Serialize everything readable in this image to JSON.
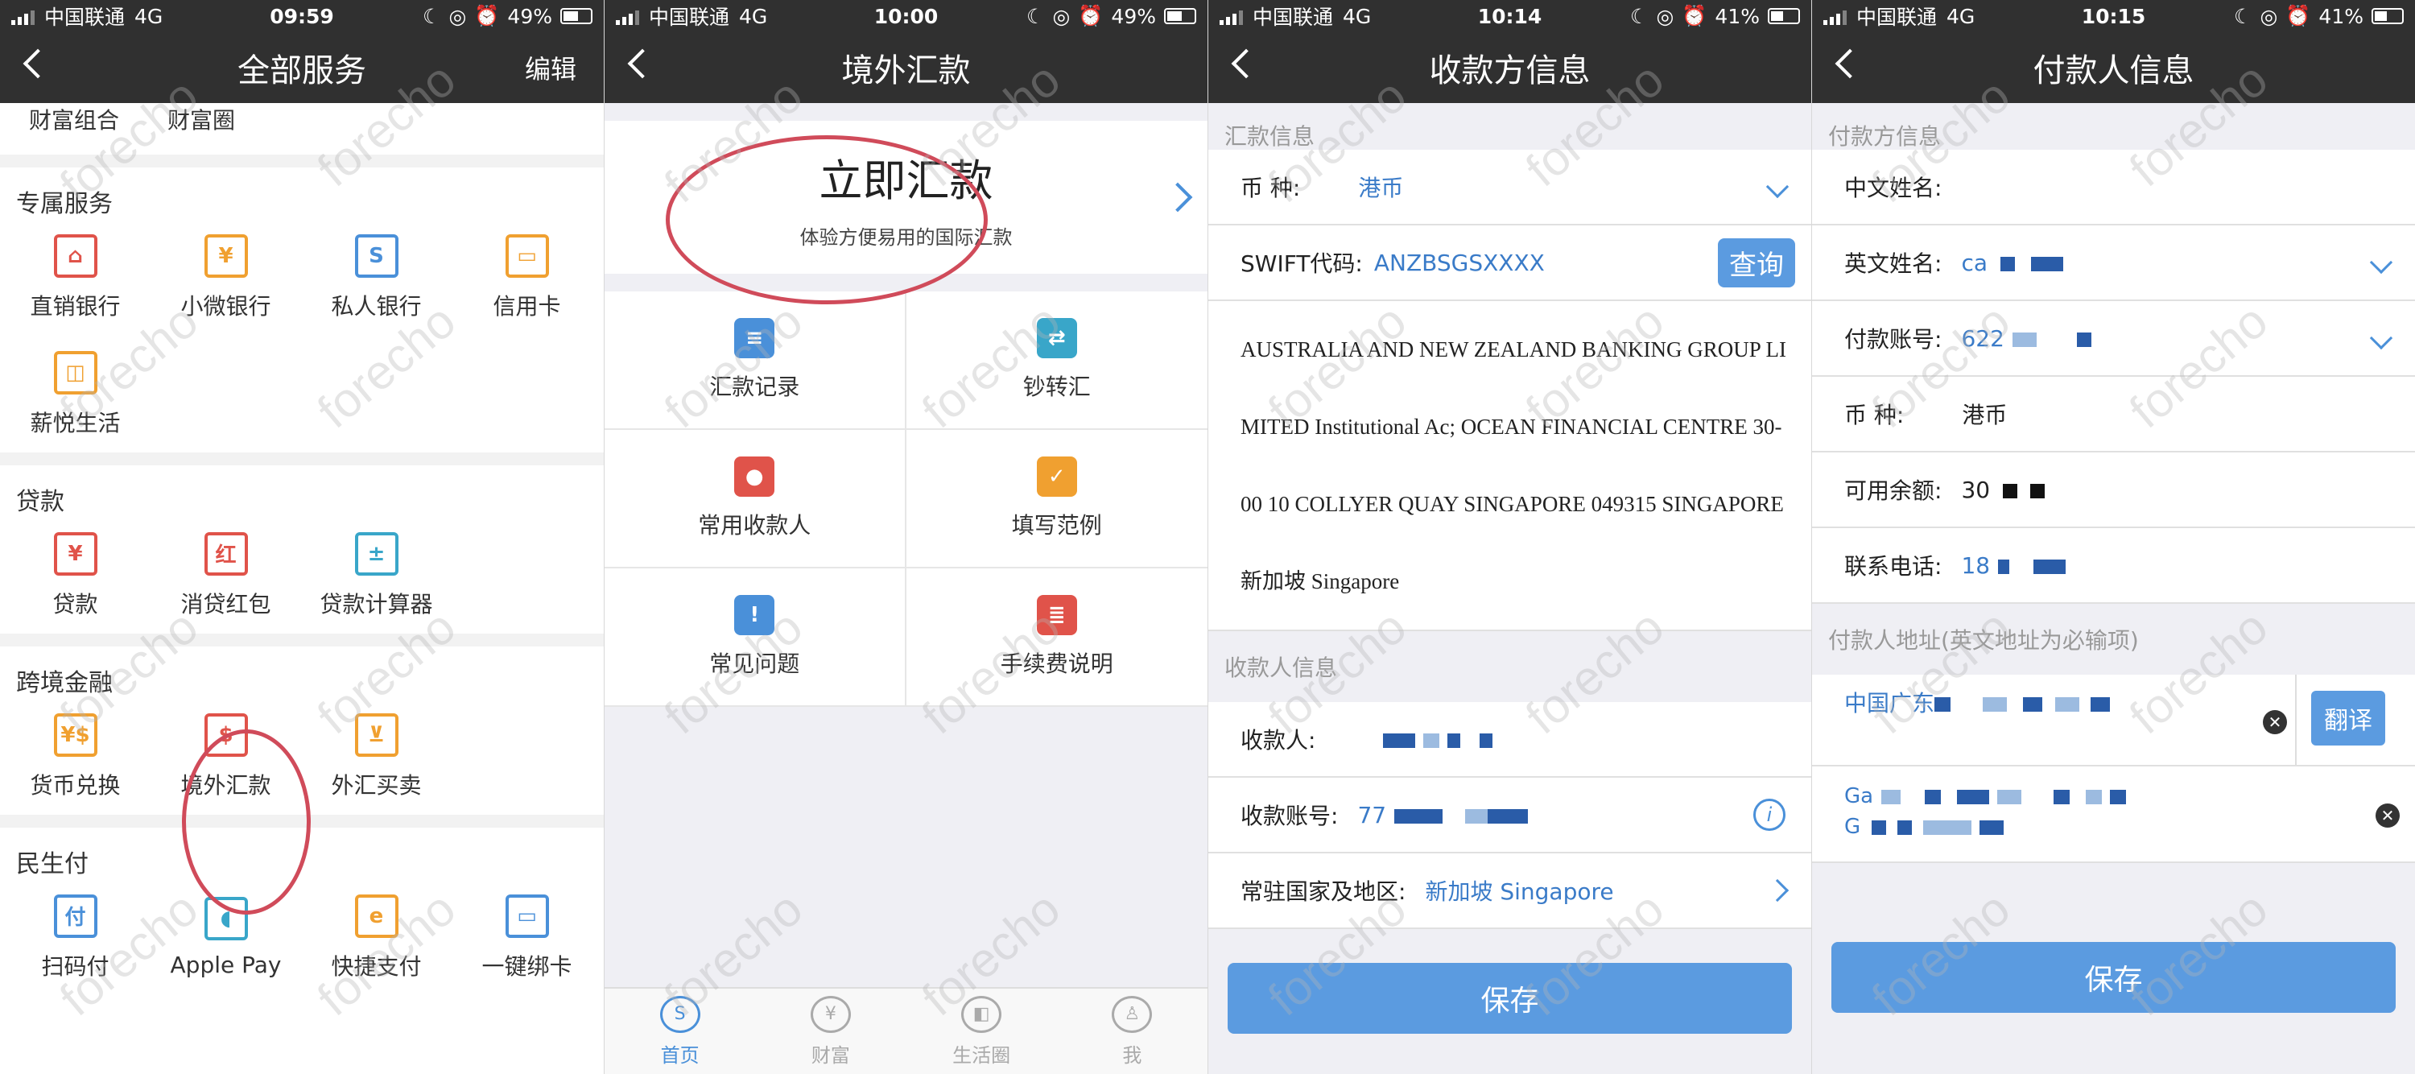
{
  "status_bars": [
    {
      "carrier": "中国联通",
      "network": "4G",
      "time": "09:59",
      "battery": "49%",
      "battery_level": 0.49
    },
    {
      "carrier": "中国联通",
      "network": "4G",
      "time": "10:00",
      "battery": "49%",
      "battery_level": 0.49
    },
    {
      "carrier": "中国联通",
      "network": "4G",
      "time": "10:14",
      "battery": "41%",
      "battery_level": 0.41
    },
    {
      "carrier": "中国联通",
      "network": "4G",
      "time": "10:15",
      "battery": "41%",
      "battery_level": 0.41
    }
  ],
  "watermark_text": "forecho",
  "panel1": {
    "title": "全部服务",
    "edit_label": "编辑",
    "top_items": [
      "财富组合",
      "财富圈"
    ],
    "sections": [
      {
        "title": "专属服务",
        "items": [
          {
            "label": "直销银行",
            "icon": "bank-icon",
            "glyph": "⌂",
            "color": "red"
          },
          {
            "label": "小微银行",
            "icon": "yen-house-icon",
            "glyph": "¥",
            "color": "orange"
          },
          {
            "label": "私人银行",
            "icon": "s-logo-icon",
            "glyph": "S",
            "color": "blue"
          },
          {
            "label": "信用卡",
            "icon": "card-icon",
            "glyph": "▭",
            "color": "orange"
          },
          {
            "label": "薪悦生活",
            "icon": "wallet-icon",
            "glyph": "◫",
            "color": "orange"
          }
        ]
      },
      {
        "title": "贷款",
        "items": [
          {
            "label": "贷款",
            "icon": "yen-bag-icon",
            "glyph": "¥",
            "color": "red"
          },
          {
            "label": "消贷红包",
            "icon": "red-packet-icon",
            "glyph": "红",
            "color": "red"
          },
          {
            "label": "贷款计算器",
            "icon": "calculator-icon",
            "glyph": "±",
            "color": "teal"
          }
        ]
      },
      {
        "title": "跨境金融",
        "items": [
          {
            "label": "货币兑换",
            "icon": "currency-exchange-icon",
            "glyph": "¥$",
            "color": "orange"
          },
          {
            "label": "境外汇款",
            "icon": "dollar-transfer-icon",
            "glyph": "$",
            "color": "red"
          },
          {
            "label": "外汇买卖",
            "icon": "cart-icon",
            "glyph": "⊻",
            "color": "orange"
          }
        ]
      },
      {
        "title": "民生付",
        "items": [
          {
            "label": "扫码付",
            "icon": "qr-pay-icon",
            "glyph": "付",
            "color": "blue"
          },
          {
            "label": "Apple Pay",
            "icon": "apple-icon",
            "glyph": "◖",
            "color": "teal"
          },
          {
            "label": "快捷支付",
            "icon": "quick-pay-icon",
            "glyph": "e",
            "color": "orange"
          },
          {
            "label": "一键绑卡",
            "icon": "bind-card-icon",
            "glyph": "▭",
            "color": "blue"
          }
        ]
      }
    ]
  },
  "panel2": {
    "title": "境外汇款",
    "banner_title": "立即汇款",
    "banner_subtitle": "体验方便易用的国际汇款",
    "tiles": [
      {
        "label": "汇款记录",
        "icon": "record-icon",
        "glyph": "≡",
        "bg": "#4a90d9"
      },
      {
        "label": "钞转汇",
        "icon": "convert-icon",
        "glyph": "⇄",
        "bg": "#39a6c9"
      },
      {
        "label": "常用收款人",
        "icon": "person-icon",
        "glyph": "●",
        "bg": "#e0534a"
      },
      {
        "label": "填写范例",
        "icon": "clipboard-icon",
        "glyph": "✓",
        "bg": "#f0a030"
      },
      {
        "label": "常见问题",
        "icon": "question-icon",
        "glyph": "!",
        "bg": "#4a90d9"
      },
      {
        "label": "手续费说明",
        "icon": "coins-icon",
        "glyph": "≣",
        "bg": "#e0534a"
      }
    ],
    "tabs": [
      {
        "label": "首页",
        "icon": "home-s-icon",
        "glyph": "S",
        "active": true
      },
      {
        "label": "财富",
        "icon": "wealth-icon",
        "glyph": "¥",
        "active": false
      },
      {
        "label": "生活圈",
        "icon": "shopping-bag-icon",
        "glyph": "◧",
        "active": false
      },
      {
        "label": "我",
        "icon": "profile-icon",
        "glyph": "♙",
        "active": false
      }
    ]
  },
  "panel3": {
    "title": "收款方信息",
    "section1": "汇款信息",
    "currency_label": "币 种:",
    "currency_value": "港币",
    "swift_label": "SWIFT代码:",
    "swift_value": "ANZBSGSXXXX",
    "query_label": "查询",
    "bank_lines": [
      "AUSTRALIA AND NEW ZEALAND BANKING GROUP LI",
      "MITED Institutional Ac; OCEAN FINANCIAL CENTRE 30-",
      "00 10 COLLYER QUAY SINGAPORE 049315 SINGAPORE",
      "新加坡 Singapore"
    ],
    "section2": "收款人信息",
    "payee_label": "收款人:",
    "account_label": "收款账号:",
    "account_prefix": "77",
    "country_label": "常驻国家及地区:",
    "country_value": "新加坡  Singapore",
    "save_label": "保存"
  },
  "panel4": {
    "title": "付款人信息",
    "section1": "付款方信息",
    "cn_name_label": "中文姓名:",
    "cn_name_value": "",
    "en_name_label": "英文姓名:",
    "en_name_prefix": "ca",
    "account_label": "付款账号:",
    "account_prefix": "622",
    "currency_label": "币 种:",
    "currency_value": "港币",
    "balance_label": "可用余额:",
    "balance_prefix": "30",
    "phone_label": "联系电话:",
    "phone_prefix": "18",
    "section2": "付款人地址(英文地址为必输项)",
    "cn_address_prefix": "中国广东",
    "translate_label": "翻译",
    "en_address_line1": "Ga",
    "en_address_line2": "G",
    "save_label": "保存"
  }
}
